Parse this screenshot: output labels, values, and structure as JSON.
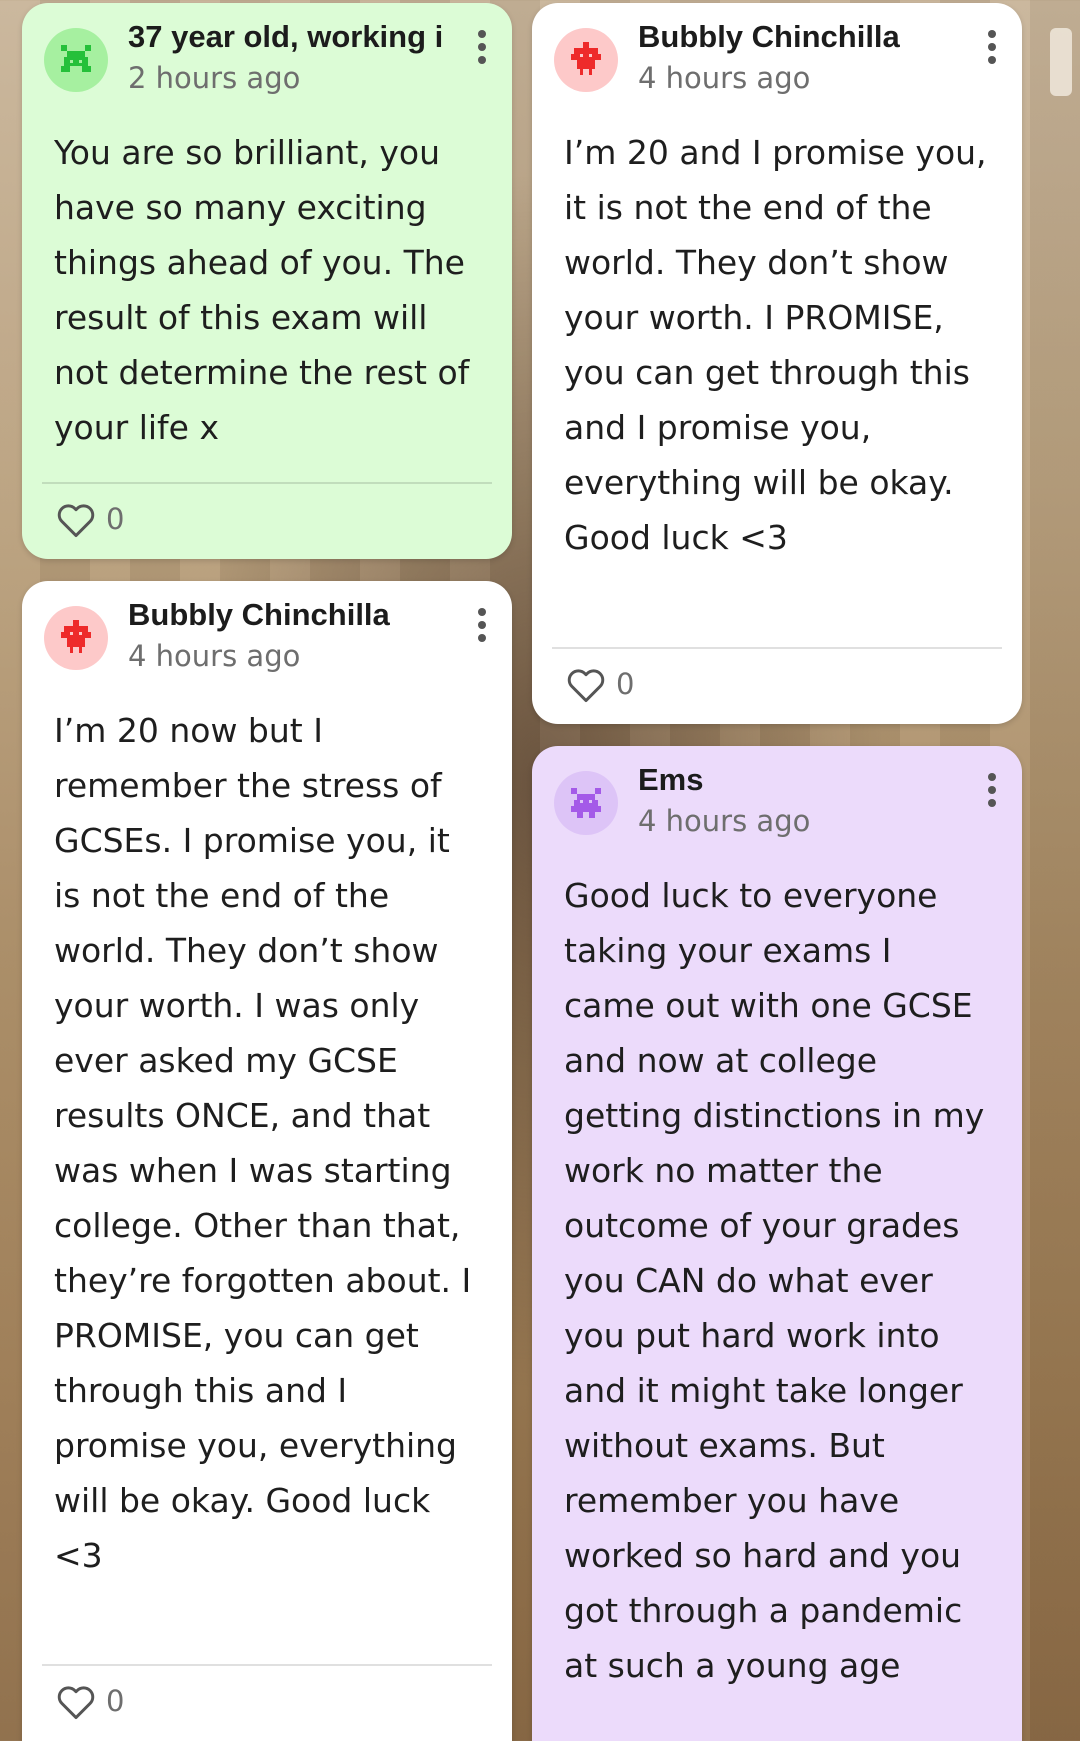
{
  "posts": [
    {
      "author": "37 year old, working i",
      "time": "2 hours ago",
      "body": "You are so brilliant, you have so many exciting things ahead of you. The result of this exam will not determine the rest of your life x",
      "likes": "0",
      "color": "#dcfcd6",
      "avatar_color": "#a6f0a0",
      "avatar_icon": "pixel-creature-icon"
    },
    {
      "author": "Bubbly Chinchilla",
      "time": "4 hours ago",
      "body": "I’m 20 and I promise you, it is not the end of the world. They don’t show your worth. I PROMISE, you can get through this and I promise you, everything will be okay. Good luck <3",
      "likes": "0",
      "color": "#ffffff",
      "avatar_color": "#fdc9c9",
      "avatar_icon": "pixel-creature-icon"
    },
    {
      "author": "Bubbly Chinchilla",
      "time": "4 hours ago",
      "body": "I’m 20 now but I remember the stress of GCSEs. I promise you, it is not the end of the world. They don’t show your worth. I was only ever asked my GCSE results ONCE, and that was when I was starting college. Other than that, they’re forgotten about. I PROMISE, you can get through this and I promise you, everything will be okay. Good luck <3",
      "likes": "0",
      "color": "#ffffff",
      "avatar_color": "#fdc9c9",
      "avatar_icon": "pixel-creature-icon"
    },
    {
      "author": "Ems",
      "time": "4 hours ago",
      "body": "Good luck to everyone taking your exams I came out with one GCSE and now at college getting distinctions in my work no matter the outcome of your grades you CAN do what ever you put hard work into and it might take longer without exams. But remember you have worked so hard and you got through a pandemic at such a young age",
      "likes": "",
      "color": "#ecdbfb",
      "avatar_color": "#ddc4f7",
      "avatar_icon": "pixel-creature-icon"
    }
  ]
}
